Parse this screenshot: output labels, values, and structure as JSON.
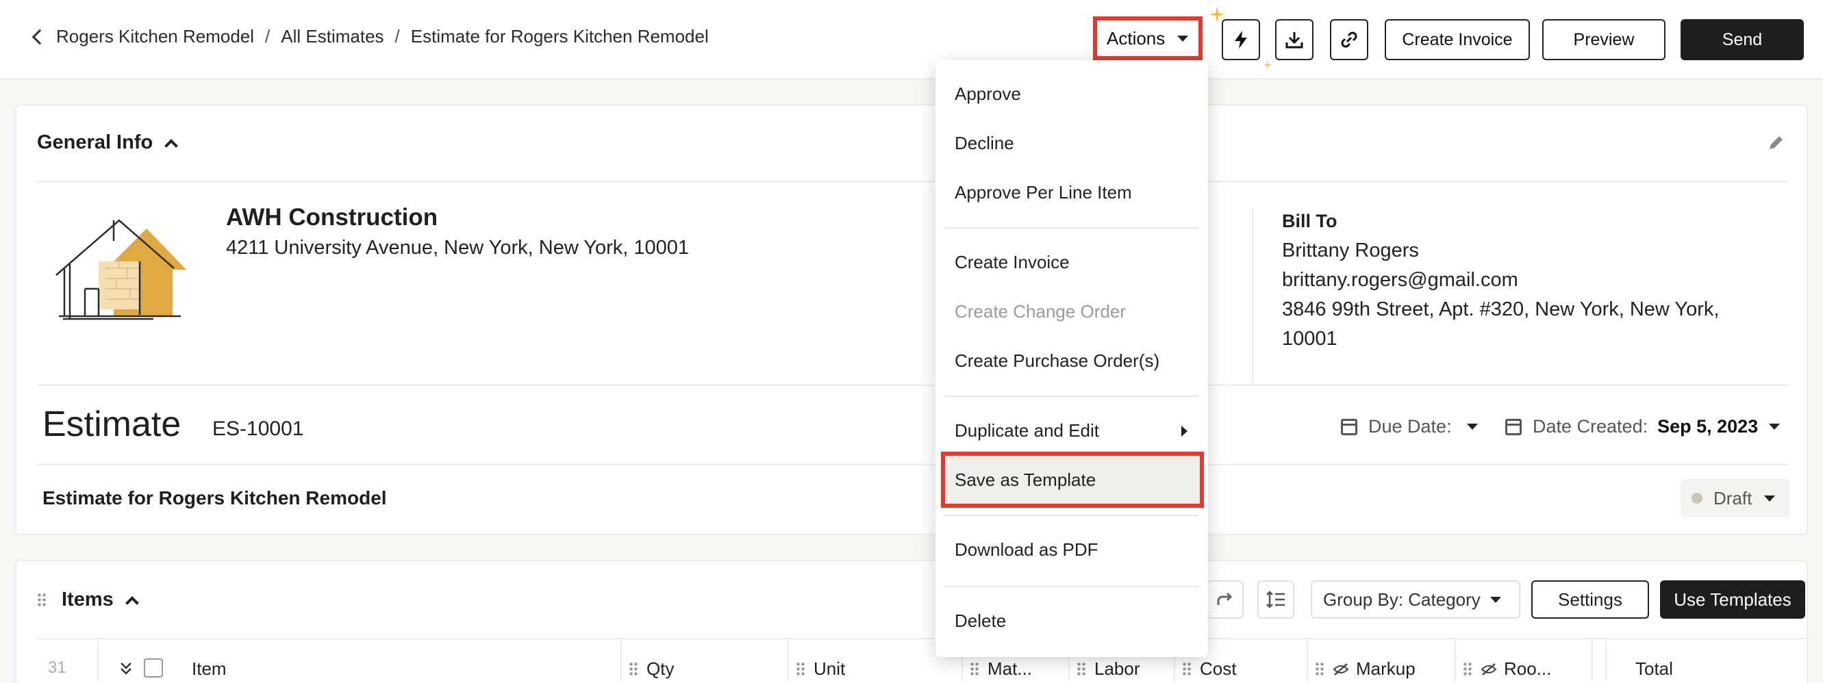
{
  "breadcrumb": {
    "items": [
      "Rogers Kitchen Remodel",
      "All Estimates",
      "Estimate for Rogers Kitchen Remodel"
    ],
    "separator": "/"
  },
  "toolbar": {
    "actions_label": "Actions",
    "create_invoice_label": "Create Invoice",
    "preview_label": "Preview",
    "send_label": "Send"
  },
  "actions_menu": {
    "items": [
      {
        "label": "Approve",
        "disabled": false
      },
      {
        "label": "Decline",
        "disabled": false
      },
      {
        "label": "Approve Per Line Item",
        "disabled": false
      },
      {
        "label": "Create Invoice",
        "disabled": false
      },
      {
        "label": "Create Change Order",
        "disabled": true
      },
      {
        "label": "Create Purchase Order(s)",
        "disabled": false
      },
      {
        "label": "Duplicate and Edit",
        "disabled": false,
        "submenu": true
      },
      {
        "label": "Save as Template",
        "disabled": false,
        "highlighted": true
      },
      {
        "label": "Download as PDF",
        "disabled": false
      },
      {
        "label": "Delete",
        "disabled": false
      }
    ]
  },
  "general_info": {
    "title": "General Info",
    "company_name": "AWH Construction",
    "company_address": "4211 University Avenue, New York, New York, 10001",
    "bill_to": {
      "title": "Bill To",
      "name": "Brittany Rogers",
      "email": "brittany.rogers@gmail.com",
      "address_line1": "3846 99th Street, Apt. #320, New York, New York,",
      "address_line2": "10001"
    },
    "estimate_title": "Estimate",
    "estimate_number": "ES-10001",
    "due_date_label": "Due Date:",
    "date_created_label": "Date Created:",
    "date_created_value": "Sep 5, 2023",
    "description": "Estimate for Rogers Kitchen Remodel",
    "status": "Draft"
  },
  "items": {
    "title": "Items",
    "group_by_label": "Group By: Category",
    "settings_label": "Settings",
    "use_templates_label": "Use Templates",
    "row_number": "31",
    "columns": [
      "Item",
      "Qty",
      "Unit",
      "Mat...",
      "Labor",
      "Cost",
      "Markup",
      "Roo...",
      "Total"
    ]
  },
  "colors": {
    "highlight_border": "#e23b2e",
    "primary_button": "#1e1e1e",
    "logo_accent": "#e0a941"
  }
}
